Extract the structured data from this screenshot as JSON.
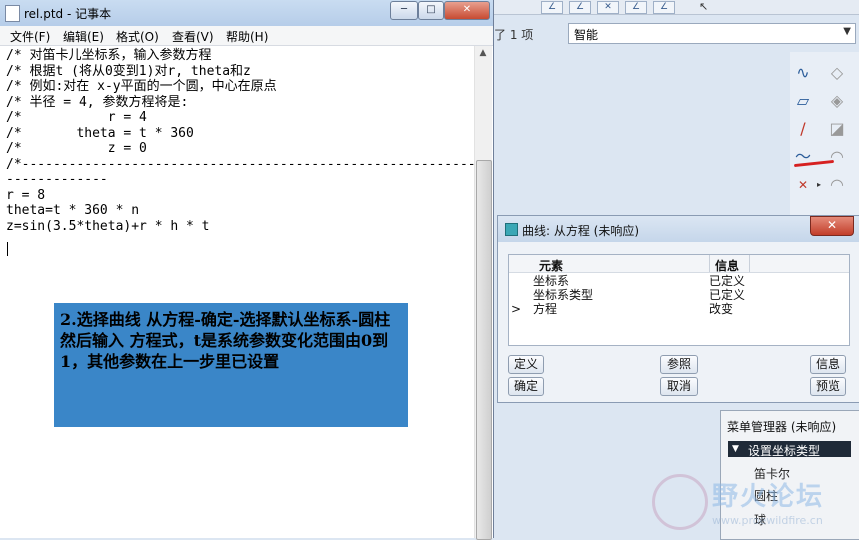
{
  "notepad": {
    "title": "rel.ptd - 记事本",
    "window_buttons": {
      "minimize": "─",
      "maximize": "□",
      "close": "✕"
    },
    "menu": [
      "文件(F)",
      "编辑(E)",
      "格式(O)",
      "查看(V)",
      "帮助(H)"
    ],
    "content": "/* 对笛卡儿坐标系，输入参数方程\n/* 根据t (将从0变到1)对r, theta和z\n/* 例如:对在 x-y平面的一个圆，中心在原点\n/* 半径 = 4, 参数方程将是:\n/*           r = 4\n/*       theta = t * 360\n/*           z = 0\n/*----------------------------------------------------------\n-------------\nr = 8\ntheta=t * 360 * n\nz=sin(3.5*theta)+r * h * t"
  },
  "annotation": {
    "text": "2.选择曲线  从方程-确定-选择默认坐标系-圆柱  然后输入 方程式，t是系统参数变化范围由0到1，其他参数在上一步里已设置"
  },
  "background_app": {
    "filter_label": "了 1 项",
    "filter_value": "智能"
  },
  "curve_dialog": {
    "title": "曲线: 从方程 (未响应)",
    "columns": [
      "元素",
      "信息"
    ],
    "rows": [
      {
        "marker": "",
        "element": "坐标系",
        "info": "已定义"
      },
      {
        "marker": "",
        "element": "坐标系类型",
        "info": "已定义"
      },
      {
        "marker": ">",
        "element": "方程",
        "info": "改变"
      }
    ],
    "buttons": {
      "define": "定义",
      "reference": "参照",
      "info": "信息",
      "ok": "确定",
      "cancel": "取消",
      "preview": "预览"
    }
  },
  "menu_manager": {
    "title": "菜单管理器 (未响应)",
    "header": "设置坐标类型",
    "items": [
      "笛卡尔",
      "圆柱",
      "球"
    ]
  },
  "watermark": {
    "text": "野火论坛",
    "url": "www.proewildfire.cn"
  }
}
